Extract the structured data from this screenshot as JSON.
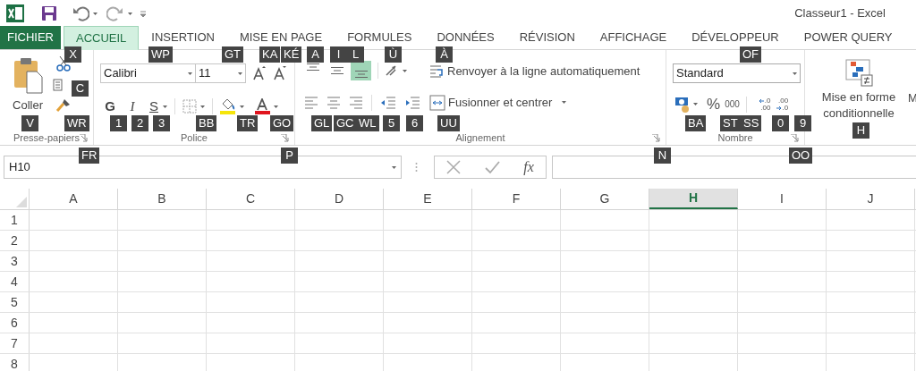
{
  "title_bar": {
    "title": "Classeur1 - Excel"
  },
  "tabs": [
    {
      "label": "FICHIER",
      "kind": "file",
      "selected": false
    },
    {
      "label": "ACCUEIL",
      "kind": "tab",
      "selected": true
    },
    {
      "label": "INSERTION",
      "kind": "tab",
      "selected": false
    },
    {
      "label": "MISE EN PAGE",
      "kind": "tab",
      "selected": false
    },
    {
      "label": "FORMULES",
      "kind": "tab",
      "selected": false
    },
    {
      "label": "DONNÉES",
      "kind": "tab",
      "selected": false
    },
    {
      "label": "RÉVISION",
      "kind": "tab",
      "selected": false
    },
    {
      "label": "AFFICHAGE",
      "kind": "tab",
      "selected": false
    },
    {
      "label": "DÉVELOPPEUR",
      "kind": "tab",
      "selected": false
    },
    {
      "label": "POWER QUERY",
      "kind": "tab",
      "selected": false
    }
  ],
  "clipboard": {
    "paste_label": "Coller",
    "group_label": "Presse-papiers"
  },
  "font": {
    "font_name": "Calibri",
    "font_size": "11",
    "bold": "G",
    "italic": "I",
    "underline": "S",
    "group_label": "Police"
  },
  "alignment": {
    "vertical": [
      {
        "kind": "top",
        "selected": false
      },
      {
        "kind": "middle",
        "selected": false
      },
      {
        "kind": "bottom",
        "selected": true
      }
    ],
    "wrap_text": "Renvoyer à la ligne automatiquement",
    "merge": "Fusionner et centrer",
    "group_label": "Alignement"
  },
  "number": {
    "format": "Standard",
    "percent": "%",
    "thousands": "000",
    "increase_decimal": [
      ".0",
      ".00"
    ],
    "decrease_decimal": [
      ".00",
      ".0"
    ],
    "group_label": "Nombre"
  },
  "styles": {
    "conditional_formatting": "Mise en forme conditionnelle",
    "next_button": "M"
  },
  "formula_bar": {
    "name_box": "H10",
    "function_button": "fx"
  },
  "sheet": {
    "columns": [
      {
        "label": "A",
        "selected": false
      },
      {
        "label": "B",
        "selected": false
      },
      {
        "label": "C",
        "selected": false
      },
      {
        "label": "D",
        "selected": false
      },
      {
        "label": "E",
        "selected": false
      },
      {
        "label": "F",
        "selected": false
      },
      {
        "label": "G",
        "selected": false
      },
      {
        "label": "H",
        "selected": true
      },
      {
        "label": "I",
        "selected": false
      },
      {
        "label": "J",
        "selected": false
      }
    ],
    "rows": [
      "1",
      "2",
      "3",
      "4",
      "5",
      "6",
      "7",
      "8"
    ]
  },
  "keytips": [
    "X",
    "WP",
    "GT",
    "KA",
    "KÉ",
    "A",
    "I",
    "L",
    "Ù",
    "À",
    "OF",
    "C",
    "V",
    "WR",
    "1",
    "2",
    "3",
    "BB",
    "TR",
    "GO",
    "GL",
    "GC",
    "WL",
    "5",
    "6",
    "UU",
    "BA",
    "ST",
    "SS",
    "0",
    "9",
    "H",
    "FR",
    "P",
    "N",
    "OO"
  ]
}
